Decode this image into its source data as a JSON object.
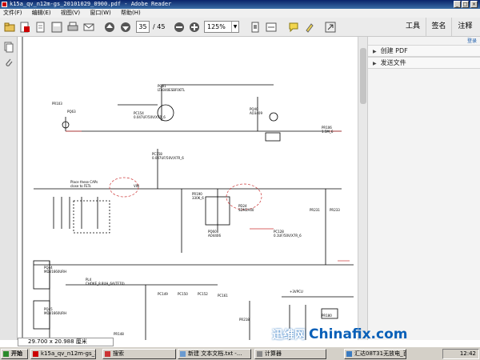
{
  "window": {
    "title": "k15a_qv_n12m-gs_20101029_0900.pdf - Adobe Reader"
  },
  "menu": [
    "文件(F)",
    "编辑(E)",
    "视图(V)",
    "窗口(W)",
    "帮助(H)"
  ],
  "toolbar": {
    "page_current": "35",
    "page_total": "/ 45",
    "zoom": "125%"
  },
  "right_tabs": [
    "工具",
    "签名",
    "注释"
  ],
  "right_panel": {
    "login_link": "登录",
    "sections": [
      "创建 PDF",
      "发送文件"
    ]
  },
  "status": {
    "page_size": "29.700 x 20.988 厘米"
  },
  "taskbar": {
    "start": "开始",
    "items": [
      "k15a_qv_n12m-gs_20...",
      "搜索",
      "新建 文本文档.txt -...",
      "计算器",
      "汇达08T31无放电_百..."
    ],
    "clock": "12:42"
  },
  "watermark": {
    "cn": "迅维网",
    "en": "Chinafix.com"
  },
  "schematic_labels": {
    "pr103": "PR103",
    "pq63": "PQ63",
    "pq81": "PQ81\nLTA040ESBF06TL",
    "pc154": "PC154\n0.047UF/50V/X7R_6",
    "pq40": "PQ40\nAO3409",
    "pr106": "PR106\n1.5M_6",
    "pc158": "PC158\n0.047UF/50V/X7R_6",
    "note": "Place these CAPs\nclose to FETs",
    "vin": "VIN",
    "pr190": "PR190\n330K_6",
    "pq60": "PQ60\nAO4406",
    "pd24": "PD24\nSDM2A40",
    "pr231": "PR231",
    "pr233": "PR233",
    "pc128": "PC128\n0.1UF/50V/X7R_6",
    "pq44": "PQ44\nMDV1660URH",
    "pq45": "PQ45\nMDV1660URH",
    "pl4": "PL4\nCHOKE_8.8UH_6A(TF70)",
    "pc149": "PC149",
    "pc150": "PC150",
    "pc152": "PC152",
    "pc161": "PC161",
    "pr218": "PR218",
    "pr148": "PR148",
    "vcc": "+3VPCU",
    "pr180": "PR180"
  }
}
